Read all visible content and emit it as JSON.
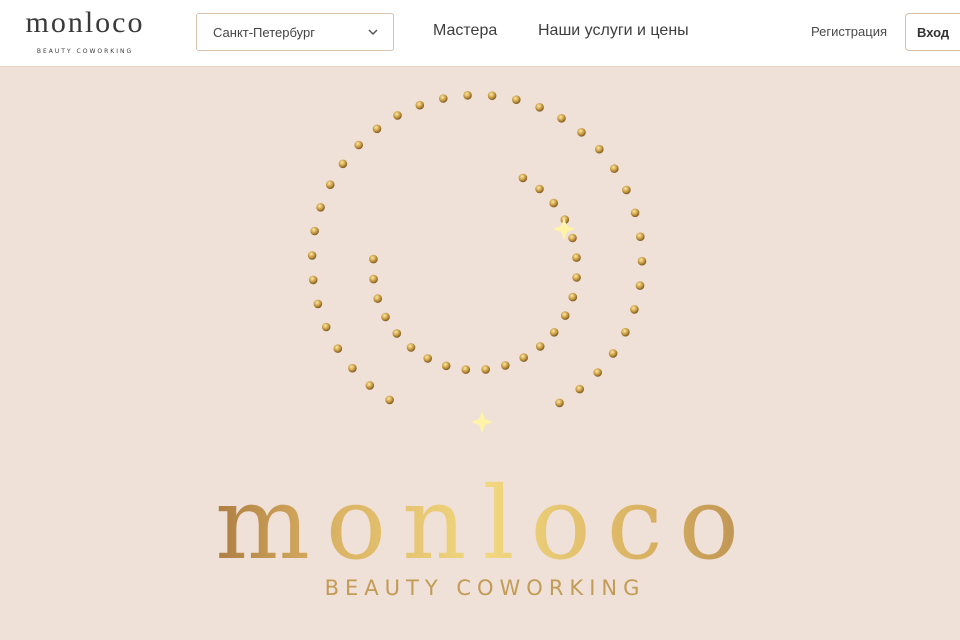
{
  "header": {
    "logo": {
      "word": "monloco",
      "subtitle": "BEAUTY COWORKING"
    },
    "city_select": {
      "value": "Санкт-Петербург",
      "icon": "chevron-down-icon"
    },
    "nav": {
      "masters": "Мастера",
      "services": "Наши услуги и цены"
    },
    "registration": "Регистрация",
    "login": "Вход"
  },
  "hero": {
    "word": "monloco",
    "tagline": "BEAUTY COWORKING",
    "colors": {
      "background": "#efe1d8",
      "gold": "#d4ac58",
      "sparkle": "#fff0a0"
    }
  }
}
